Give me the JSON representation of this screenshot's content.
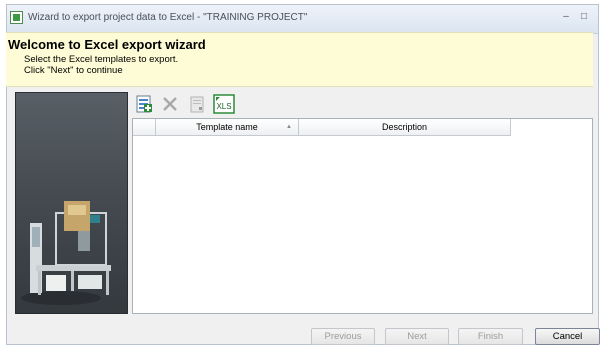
{
  "window": {
    "title": "Wizard to export project data to Excel - \"TRAINING PROJECT\"",
    "minimize_glyph": "–",
    "maximize_glyph": "□"
  },
  "header": {
    "title": "Welcome to Excel export wizard",
    "line1": "Select the Excel templates to export.",
    "line2": "Click \"Next\" to continue"
  },
  "toolbar": {
    "buttons": [
      {
        "icon": "new-template-icon"
      },
      {
        "icon": "delete-icon"
      },
      {
        "icon": "properties-icon"
      },
      {
        "icon": "xls-icon",
        "label": "XLS"
      }
    ]
  },
  "grid": {
    "columns": [
      "",
      "Template name",
      "Description"
    ],
    "rows": []
  },
  "footer": {
    "previous": "Previous",
    "next": "Next",
    "finish": "Finish",
    "cancel": "Cancel"
  },
  "colors": {
    "header_bg": "#fdfcd6",
    "side_panel": "#454b51",
    "xls_green": "#2e8b3a"
  }
}
